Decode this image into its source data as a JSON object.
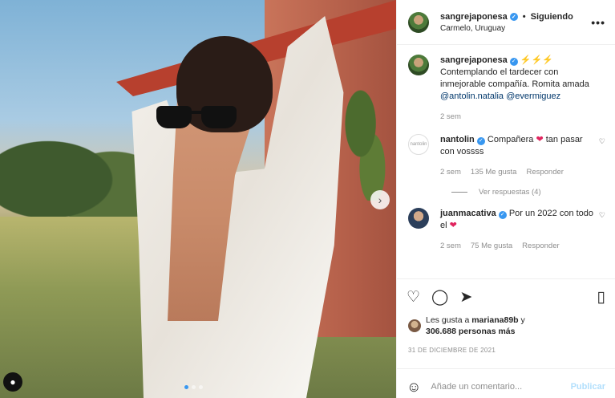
{
  "post": {
    "username": "sangrejaponesa",
    "following_label": "Siguiendo",
    "location": "Carmelo, Uruguay",
    "more_label": "•••"
  },
  "caption": {
    "username": "sangrejaponesa",
    "emoji": "⚡⚡⚡",
    "text": "Contemplando el tardecer con inmejorable compañía. Romita amada",
    "mention1": "@antolin.natalia",
    "mention2": "@evermiguez",
    "time": "2 sem"
  },
  "comments": [
    {
      "username": "nantolin",
      "text_before": "Compañera",
      "emoji": "❤",
      "text_after": "tan pasar con vossss",
      "time": "2 sem",
      "likes": "135 Me gusta",
      "reply": "Responder",
      "avatar_text": "nantolin"
    },
    {
      "username": "juanmacativa",
      "text_before": "Por un 2022 con todo el",
      "emoji": "❤",
      "text_after": "",
      "time": "2 sem",
      "likes": "75 Me gusta",
      "reply": "Responder"
    }
  ],
  "replies_label": "Ver respuestas (4)",
  "likes": {
    "prefix": "Les gusta a",
    "user": "mariana89b",
    "middle": "y",
    "count": "306.688 personas más"
  },
  "date": "31 DE DICIEMBRE DE 2021",
  "add_comment": {
    "placeholder": "Añade un comentario...",
    "publish": "Publicar"
  },
  "icons": {
    "next": "chevron-right-icon",
    "tag": "user-tag-icon",
    "like": "heart-icon",
    "comment": "comment-icon",
    "share": "send-icon",
    "save": "bookmark-icon",
    "emoji": "emoji-icon"
  },
  "colors": {
    "verified": "#3897f0",
    "heart": "#e0245e",
    "publish": "#b2dffc"
  }
}
